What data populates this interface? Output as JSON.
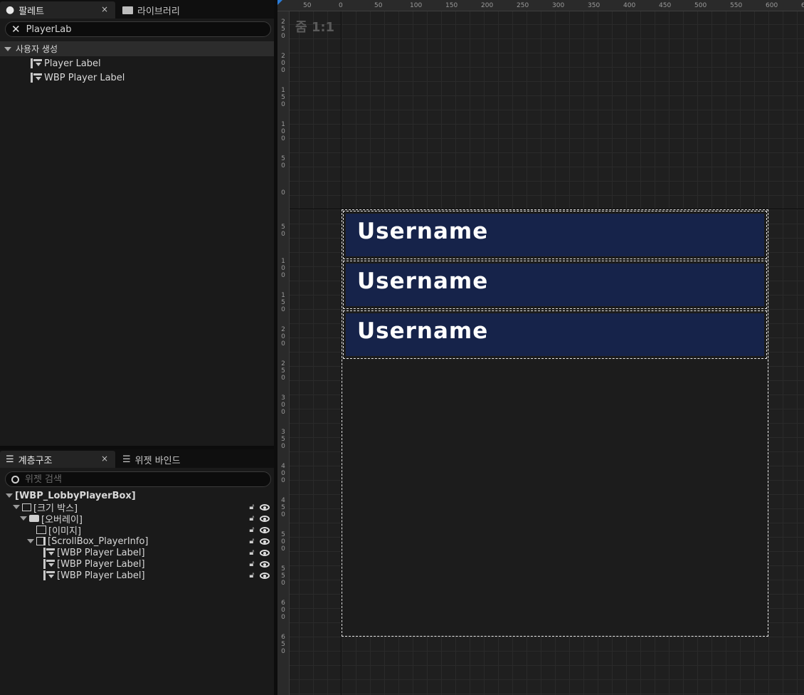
{
  "palette": {
    "tabs": [
      {
        "label": "팔레트",
        "close": "×"
      },
      {
        "label": "라이브러리"
      }
    ],
    "search": {
      "value": "PlayerLab",
      "placeholder": ""
    },
    "category": "사용자 생성",
    "items": [
      {
        "label": "Player Label"
      },
      {
        "label": "WBP Player Label"
      }
    ]
  },
  "hierarchy": {
    "tabs": [
      {
        "label": "계층구조",
        "close": "×"
      },
      {
        "label": "위젯 바인드"
      }
    ],
    "search": {
      "value": "",
      "placeholder": "위젯 검색"
    },
    "root": "[WBP_LobbyPlayerBox]",
    "nodes": [
      {
        "label": "[크기 박스]",
        "icon": "size-box-icon"
      },
      {
        "label": "[오버레이]",
        "icon": "overlay-icon"
      },
      {
        "label": "[이미지]",
        "icon": "image-icon"
      },
      {
        "label": "[ScrollBox_PlayerInfo]",
        "icon": "scrollbox-icon"
      },
      {
        "label": "[WBP Player Label]",
        "icon": "widget-icon"
      },
      {
        "label": "[WBP Player Label]",
        "icon": "widget-icon"
      },
      {
        "label": "[WBP Player Label]",
        "icon": "widget-icon"
      }
    ]
  },
  "viewport": {
    "zoom": "줌 1:1",
    "ruler_top": [
      "50",
      "0",
      "50",
      "100",
      "150",
      "200",
      "250",
      "300",
      "350",
      "400",
      "450",
      "500",
      "550",
      "600",
      "65"
    ],
    "ruler_left": [
      "250",
      "200",
      "150",
      "100",
      "50",
      "0",
      "50",
      "100",
      "150",
      "200",
      "250",
      "300",
      "350",
      "400",
      "450",
      "500",
      "550",
      "600",
      "650"
    ],
    "labels": [
      "Username",
      "Username",
      "Username"
    ]
  },
  "colors": {
    "label_bg": "#16234a",
    "selection": "#e8e8e8",
    "accent": "#2a7cd8"
  }
}
